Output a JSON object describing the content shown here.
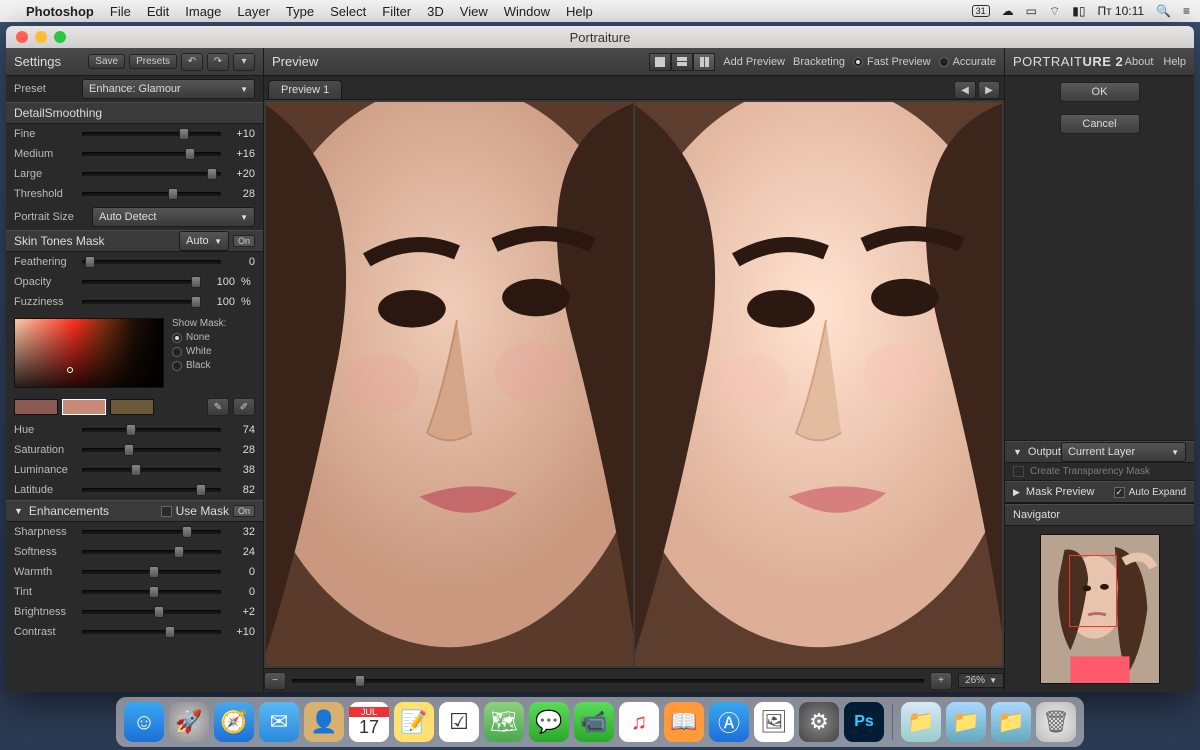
{
  "menubar": {
    "app": "Photoshop",
    "items": [
      "File",
      "Edit",
      "Image",
      "Layer",
      "Type",
      "Select",
      "Filter",
      "3D",
      "View",
      "Window",
      "Help"
    ],
    "clock": "Пт 10:11"
  },
  "window": {
    "title": "Portraiture"
  },
  "settings": {
    "title": "Settings",
    "save_label": "Save",
    "presets_label": "Presets",
    "preset_label": "Preset",
    "preset_value": "Enhance: Glamour"
  },
  "detail_smoothing": {
    "title": "DetailSmoothing",
    "fine": {
      "label": "Fine",
      "value": "+10",
      "pos": 70
    },
    "medium": {
      "label": "Medium",
      "value": "+16",
      "pos": 74
    },
    "large": {
      "label": "Large",
      "value": "+20",
      "pos": 90
    },
    "threshold": {
      "label": "Threshold",
      "value": "28",
      "pos": 62
    },
    "portrait_size_label": "Portrait Size",
    "portrait_size_value": "Auto Detect"
  },
  "skin_tones": {
    "title": "Skin Tones Mask",
    "mode": "Auto",
    "on_label": "On",
    "feathering": {
      "label": "Feathering",
      "value": "0",
      "pos": 2
    },
    "opacity": {
      "label": "Opacity",
      "value": "100",
      "pct": "%",
      "pos": 96
    },
    "fuzziness": {
      "label": "Fuzziness",
      "value": "100",
      "pct": "%",
      "pos": 96
    },
    "show_mask_label": "Show Mask:",
    "mask_options": [
      "None",
      "White",
      "Black"
    ],
    "mask_selected": "None",
    "hue": {
      "label": "Hue",
      "value": "74",
      "pos": 32
    },
    "saturation": {
      "label": "Saturation",
      "value": "28",
      "pos": 30
    },
    "luminance": {
      "label": "Luminance",
      "value": "38",
      "pos": 35
    },
    "latitude": {
      "label": "Latitude",
      "value": "82",
      "pos": 82
    }
  },
  "enhancements": {
    "title": "Enhancements",
    "use_mask_label": "Use Mask",
    "on_label": "On",
    "sharpness": {
      "label": "Sharpness",
      "value": "32",
      "pos": 72
    },
    "softness": {
      "label": "Softness",
      "value": "24",
      "pos": 66
    },
    "warmth": {
      "label": "Warmth",
      "value": "0",
      "pos": 48
    },
    "tint": {
      "label": "Tint",
      "value": "0",
      "pos": 48
    },
    "brightness": {
      "label": "Brightness",
      "value": "+2",
      "pos": 52
    },
    "contrast": {
      "label": "Contrast",
      "value": "+10",
      "pos": 60
    }
  },
  "preview": {
    "title": "Preview",
    "add_preview": "Add Preview",
    "bracketing": "Bracketing",
    "fast_preview": "Fast Preview",
    "accurate": "Accurate",
    "tab_label": "Preview 1",
    "zoom": "26%"
  },
  "right": {
    "brand_prefix": "PORTRAIT",
    "brand_suffix": "URE 2",
    "about": "About",
    "help": "Help",
    "ok": "OK",
    "cancel": "Cancel",
    "output_title": "Output",
    "output_mode": "Current Layer",
    "create_mask_label": "Create Transparency Mask",
    "mask_preview_title": "Mask Preview",
    "auto_expand_label": "Auto Expand",
    "navigator_title": "Navigator"
  },
  "dock": {
    "items": [
      "finder",
      "launchpad",
      "safari",
      "mail",
      "contacts",
      "calendar",
      "notes",
      "reminders",
      "maps",
      "messages",
      "facetime",
      "itunes",
      "ibooks",
      "appstore",
      "preview",
      "settings",
      "photoshop"
    ],
    "right_items": [
      "folder1",
      "folder2",
      "folder3",
      "trash"
    ]
  }
}
